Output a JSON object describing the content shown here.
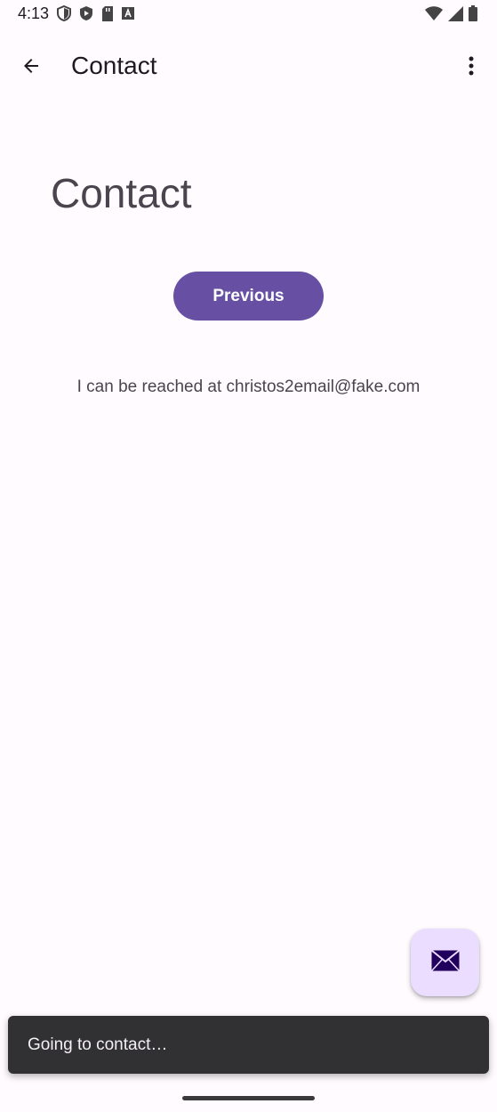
{
  "status_bar": {
    "time": "4:13",
    "icons": [
      "shield-icon",
      "play-protect-icon",
      "sd-card-icon",
      "font-a-icon"
    ],
    "right_icons": [
      "wifi-icon",
      "signal-icon",
      "battery-icon"
    ]
  },
  "app_bar": {
    "title": "Contact",
    "back_icon": "arrow-back-icon",
    "overflow_icon": "more-vert-icon"
  },
  "main": {
    "heading": "Contact",
    "previous_label": "Previous",
    "contact_text": "I can be reached at christos2email@fake.com"
  },
  "fab": {
    "icon": "mail-icon"
  },
  "snackbar": {
    "text": "Going to contact…"
  },
  "colors": {
    "primary": "#6750a4",
    "background": "#fffbfe",
    "fab": "#eaddff",
    "snackbar": "#313033"
  }
}
